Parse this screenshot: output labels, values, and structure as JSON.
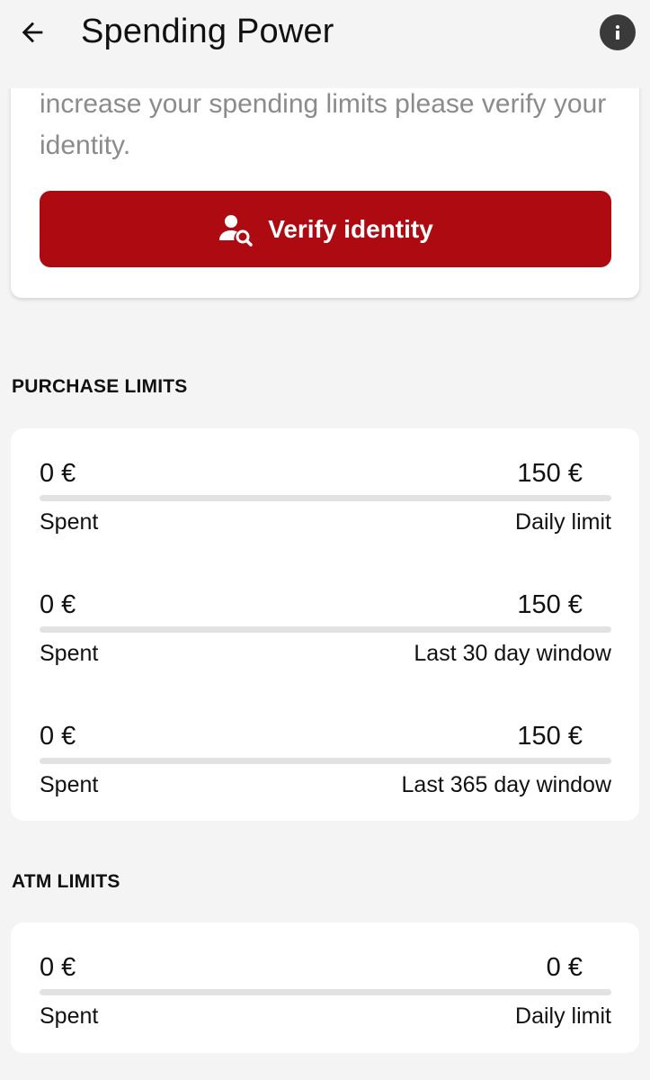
{
  "header": {
    "title": "Spending Power"
  },
  "verify": {
    "text": "increase your spending limits please verify your identity.",
    "button_label": "Verify identity"
  },
  "purchase": {
    "section_title": "PURCHASE LIMITS",
    "rows": [
      {
        "spent_amount": "0 €",
        "limit_amount": "150 €",
        "spent_label": "Spent",
        "limit_label": "Daily limit",
        "progress": 0
      },
      {
        "spent_amount": "0 €",
        "limit_amount": "150 €",
        "spent_label": "Spent",
        "limit_label": "Last 30 day window",
        "progress": 0
      },
      {
        "spent_amount": "0 €",
        "limit_amount": "150 €",
        "spent_label": "Spent",
        "limit_label": "Last 365 day window",
        "progress": 0
      }
    ]
  },
  "atm": {
    "section_title": "ATM LIMITS",
    "rows": [
      {
        "spent_amount": "0 €",
        "limit_amount": "0 €",
        "spent_label": "Spent",
        "limit_label": "Daily limit",
        "progress": 0
      }
    ]
  },
  "colors": {
    "accent": "#ad0a12",
    "background": "#f4f4f4",
    "track": "#e2e2e2"
  },
  "icons": {
    "back": "arrow-back-icon",
    "info": "info-icon",
    "verify": "person-search-icon"
  }
}
